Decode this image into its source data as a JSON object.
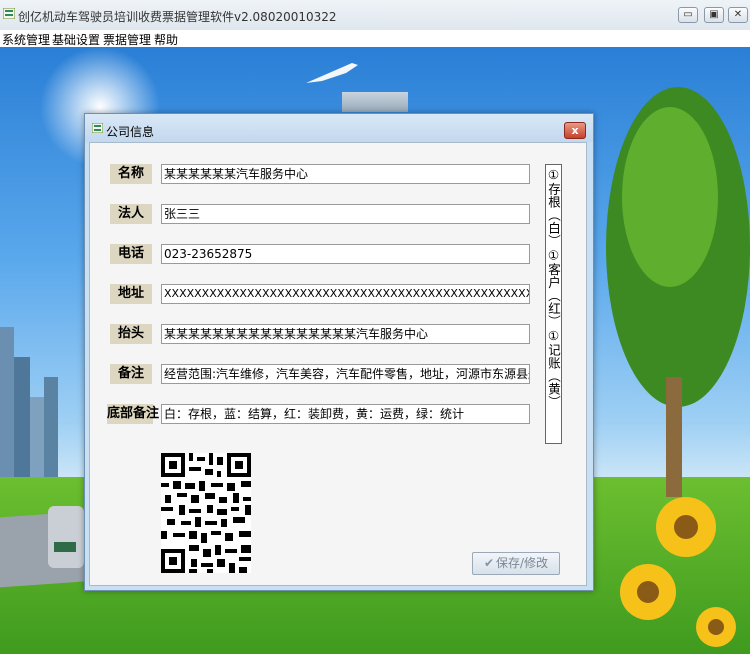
{
  "window": {
    "title": "创亿机动车驾驶员培训收费票据管理软件v2.08020010322",
    "buttons": {
      "minimize": "▭",
      "maximize": "▣",
      "close": "✕"
    }
  },
  "menu": {
    "items": [
      {
        "label": "系统管理"
      },
      {
        "label": "基础设置"
      },
      {
        "label": "票据管理"
      },
      {
        "label": "帮助"
      }
    ]
  },
  "dialog": {
    "title": "公司信息",
    "close_glyph": "x",
    "fields": {
      "name": {
        "label": "名称",
        "value": "某某某某某某汽车服务中心"
      },
      "legal": {
        "label": "法人",
        "value": "张三三"
      },
      "phone": {
        "label": "电话",
        "value": "023-23652875"
      },
      "address": {
        "label": "地址",
        "value": "XXXXXXXXXXXXXXXXXXXXXXXXXXXXXXXXXXXXXXXXXXXXXXXXXXXXXXXXXXXXXXXXXXXXXXXXXXx"
      },
      "header": {
        "label": "抬头",
        "value": "某某某某某某某某某某某某某某某某汽车服务中心"
      },
      "remark": {
        "label": "备注",
        "value": "经营范围:汽车维修，汽车美容，汽车配件零售，地址，河源市东源县船塘镇"
      },
      "footer_remark": {
        "label": "底部备注",
        "value": "白：存根，蓝：结算，红：装卸费，黄：运费，绿：统计"
      }
    },
    "copy_legend": "①存根（白）①客户（红）①记账（黄）",
    "save_button": "保存/修改",
    "save_icon": "check-icon"
  },
  "colors": {
    "label_bg": "#ddd6c0",
    "dialog_frame": "#c9dff2",
    "close_red": "#c6412b"
  }
}
